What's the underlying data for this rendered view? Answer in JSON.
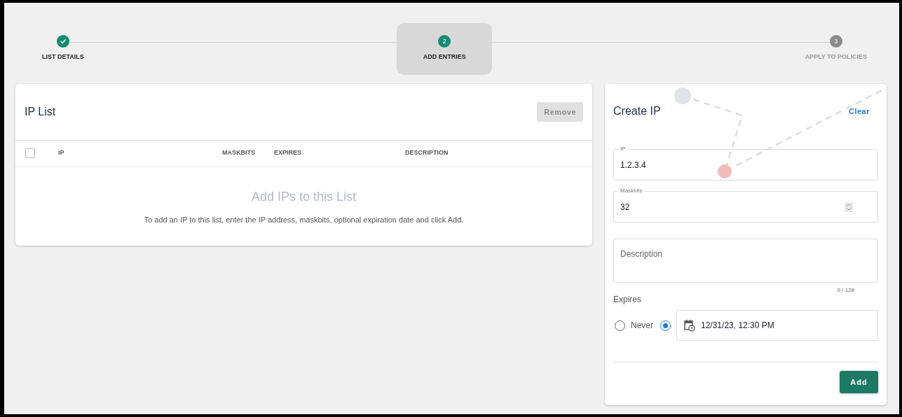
{
  "stepper": [
    {
      "kind": "done",
      "label": "LIST DETAILS",
      "selected": false
    },
    {
      "kind": "active",
      "number": "2",
      "label": "ADD ENTRIES",
      "selected": true
    },
    {
      "kind": "pending",
      "number": "3",
      "label": "APPLY TO POLICIES",
      "selected": false
    }
  ],
  "ip_list": {
    "title": "IP List",
    "remove_button": {
      "label": "Remove",
      "disabled": true
    },
    "table": {
      "select_all_checked": false,
      "columns": [
        "IP",
        "MASKBITS",
        "EXPIRES",
        "DESCRIPTION"
      ]
    },
    "empty_title": "Add IPs to this List",
    "empty_text": "To add an IP to this list, enter the IP address, maskbits, optional expiration date and click Add."
  },
  "create_ip": {
    "title": "Create IP",
    "clear_link": "Clear",
    "ip_field": {
      "label": "IP",
      "value": "1.2.3.4"
    },
    "maskbits_field": {
      "label": "Maskbits",
      "value": "32"
    },
    "description_field": {
      "placeholder": "Description",
      "counter": "0 / 128"
    },
    "expires": {
      "label": "Expires",
      "options": [
        {
          "label": "Never",
          "selected": false
        },
        {
          "selected": true
        }
      ],
      "date_value": "12/31/23, 12:30 PM"
    },
    "add_button": "Add"
  }
}
